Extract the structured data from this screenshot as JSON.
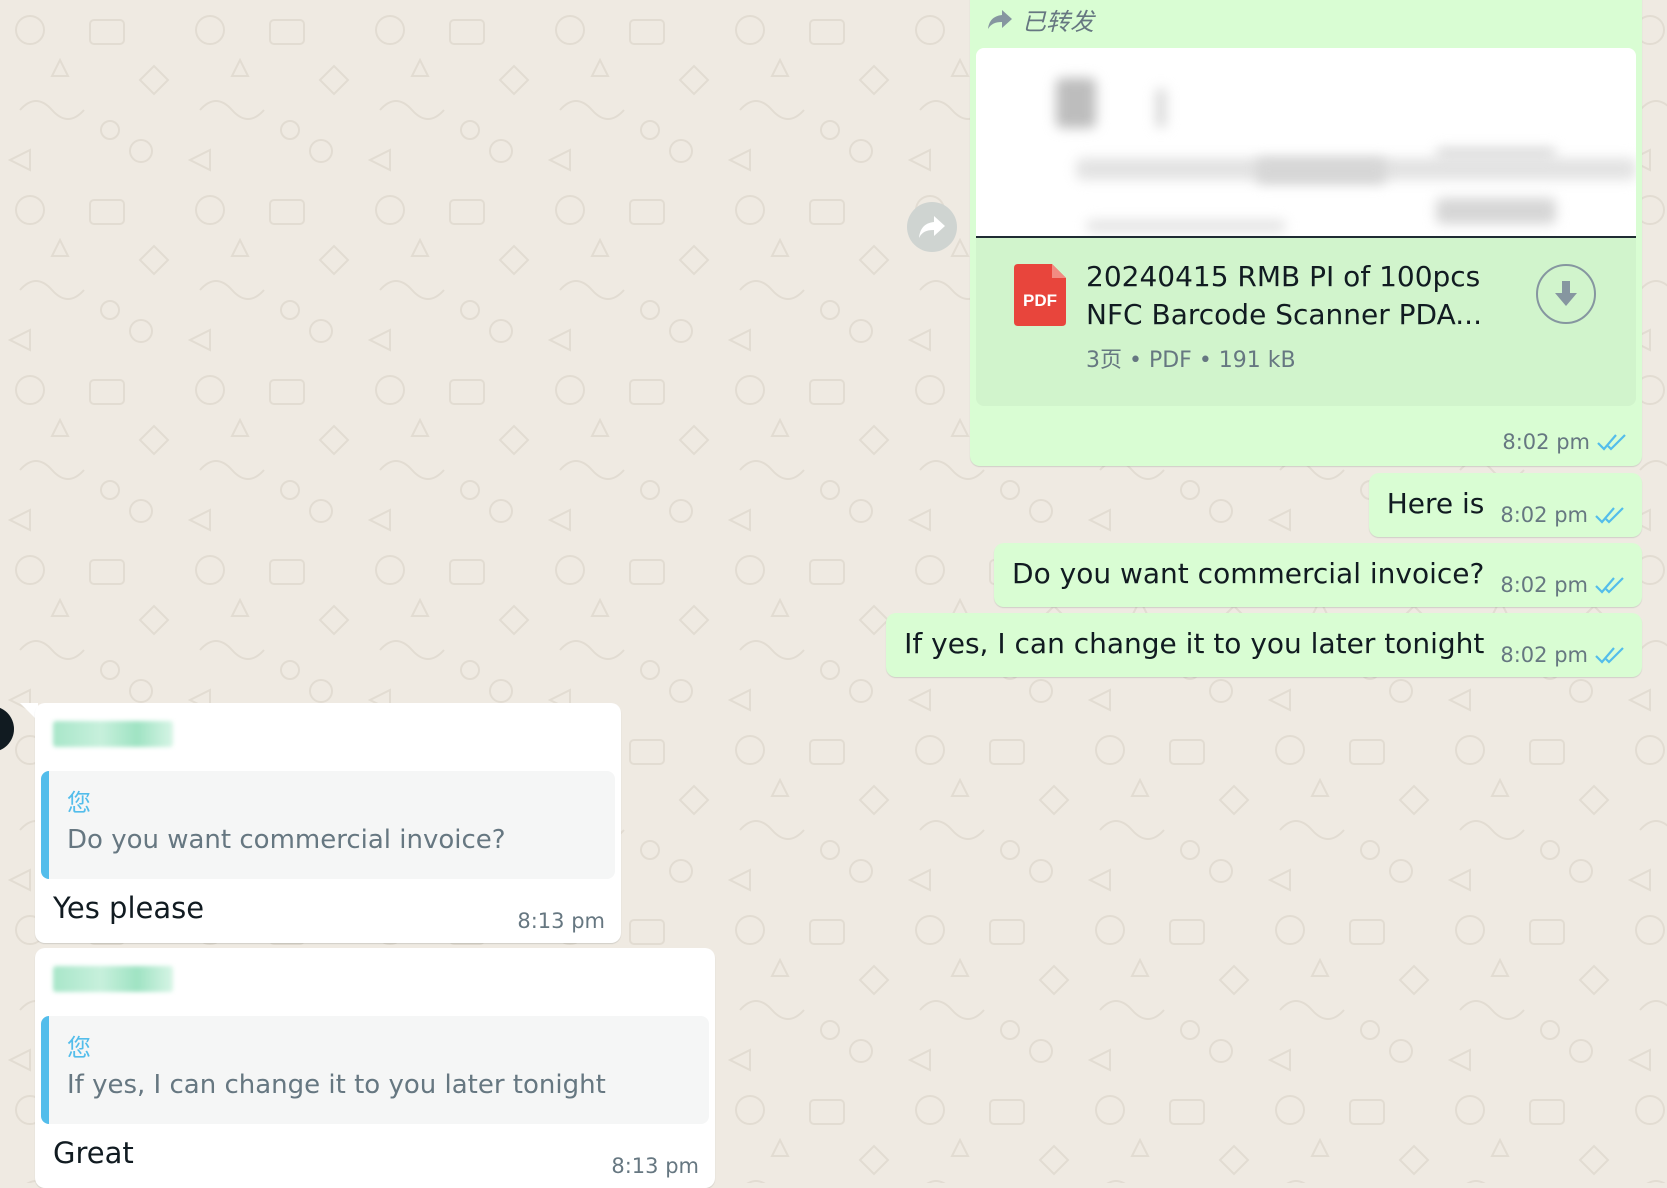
{
  "forwarded_document": {
    "forwarded_label": "已转发",
    "file_icon": "pdf-icon",
    "file_icon_text": "PDF",
    "file_name": "20240415 RMB PI of 100pcs NFC Barcode Scanner PDA...",
    "file_meta": "3页 • PDF • 191 kB",
    "time": "8:02 pm",
    "status": "read"
  },
  "outgoing_messages": [
    {
      "text": "Here is",
      "time": "8:02 pm",
      "status": "read"
    },
    {
      "text": "Do you want commercial invoice?",
      "time": "8:02 pm",
      "status": "read"
    },
    {
      "text": "If yes, I can change it to you later tonight",
      "time": "8:02 pm",
      "status": "read"
    }
  ],
  "incoming_messages": [
    {
      "quote_author": "您",
      "quote_text": "Do you want commercial invoice?",
      "text": "Yes please",
      "time": "8:13 pm"
    },
    {
      "quote_author": "您",
      "quote_text": "If yes, I can change it to you later tonight",
      "text": "Great",
      "time": "8:13 pm"
    }
  ],
  "colors": {
    "chat_background": "#efeae2",
    "outgoing_bubble": "#d9fdd3",
    "incoming_bubble": "#ffffff",
    "read_ticks": "#53bdeb",
    "quote_bar": "#53bdeb",
    "pdf_red": "#e8453c"
  }
}
